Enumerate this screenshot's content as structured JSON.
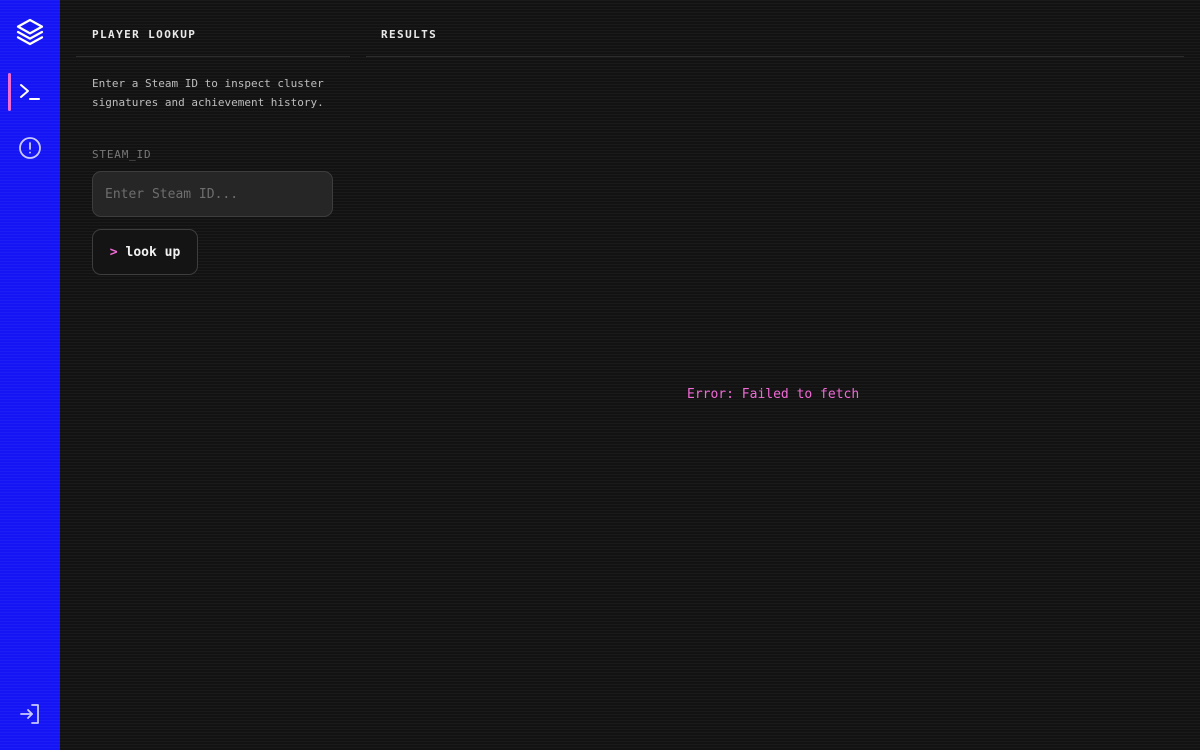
{
  "sidebar": {
    "logo_icon": "layers-icon",
    "items": [
      {
        "id": "lookup",
        "icon": "terminal-icon",
        "active": true
      },
      {
        "id": "alerts",
        "icon": "alert-circle-icon",
        "active": false
      }
    ],
    "footer_icon": "sign-in-icon"
  },
  "lookup_panel": {
    "title": "PLAYER LOOKUP",
    "description": "Enter a Steam ID to inspect cluster signatures and achievement history.",
    "field_label": "STEAM_ID",
    "input_placeholder": "Enter Steam ID...",
    "input_value": "",
    "button_prompt": ">",
    "button_label": "look up"
  },
  "results_panel": {
    "title": "RESULTS",
    "error": "Error: Failed to fetch"
  },
  "colors": {
    "sidebar": "#1414f5",
    "accent": "#f06ad6",
    "background": "#121212"
  }
}
